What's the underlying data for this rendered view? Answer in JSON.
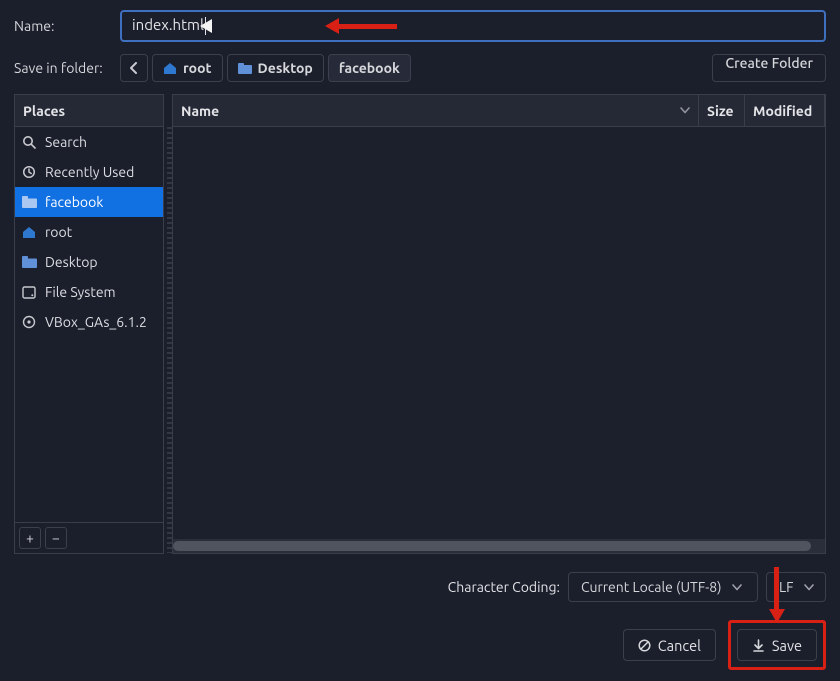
{
  "labels": {
    "name": "Name:",
    "save_in_folder": "Save in folder:",
    "create_folder": "Create Folder",
    "places_header": "Places",
    "col_name": "Name",
    "col_size": "Size",
    "col_modified": "Modified",
    "character_coding": "Character Coding:",
    "cancel": "Cancel",
    "save": "Save",
    "plus": "+",
    "minus": "−"
  },
  "filename": "index.html",
  "breadcrumb": [
    {
      "label": "root",
      "icon": "home"
    },
    {
      "label": "Desktop",
      "icon": "folder"
    },
    {
      "label": "facebook",
      "icon": null
    }
  ],
  "places": [
    {
      "label": "Search",
      "icon": "search",
      "selected": false
    },
    {
      "label": "Recently Used",
      "icon": "recent",
      "selected": false
    },
    {
      "label": "facebook",
      "icon": "folder",
      "selected": true
    },
    {
      "label": "root",
      "icon": "home",
      "selected": false
    },
    {
      "label": "Desktop",
      "icon": "folder",
      "selected": false
    },
    {
      "label": "File System",
      "icon": "disk",
      "selected": false
    },
    {
      "label": "VBox_GAs_6.1.2",
      "icon": "disc",
      "selected": false
    }
  ],
  "encoding": {
    "charset": "Current Locale (UTF-8)",
    "line_ending": "LF"
  }
}
